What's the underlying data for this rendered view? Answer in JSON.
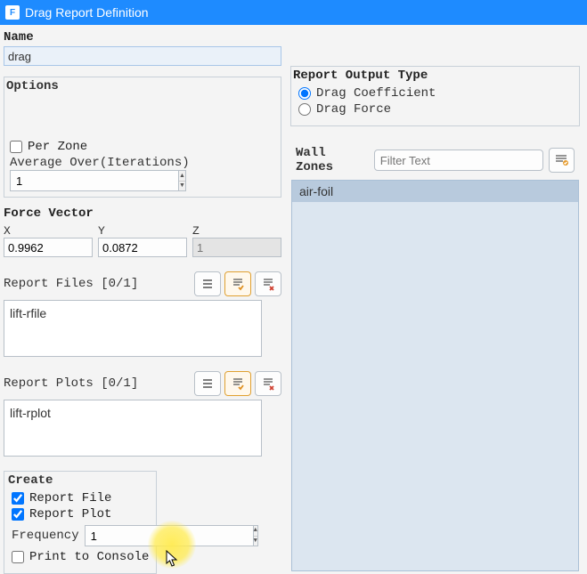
{
  "titlebar": {
    "icon": "F",
    "title": "Drag Report Definition"
  },
  "name": {
    "label": "Name",
    "value": "drag"
  },
  "options": {
    "header": "Options",
    "per_zone_label": "Per Zone",
    "per_zone_checked": false,
    "average_over_label": "Average Over(Iterations)",
    "average_over_value": "1"
  },
  "force_vector": {
    "header": "Force Vector",
    "x_label": "X",
    "x_value": "0.9962",
    "y_label": "Y",
    "y_value": "0.0872",
    "z_label": "Z",
    "z_value": "1"
  },
  "report_files": {
    "title": "Report Files [0/1]",
    "items": [
      "lift-rfile"
    ]
  },
  "report_plots": {
    "title": "Report Plots [0/1]",
    "items": [
      "lift-rplot"
    ]
  },
  "create": {
    "header": "Create",
    "report_file_label": "Report File",
    "report_file_checked": true,
    "report_plot_label": "Report Plot",
    "report_plot_checked": true,
    "frequency_label": "Frequency",
    "frequency_value": "1",
    "print_console_label": "Print to Console",
    "print_console_checked": false
  },
  "output_type": {
    "header": "Report Output Type",
    "drag_coeff_label": "Drag Coefficient",
    "drag_force_label": "Drag Force",
    "selected": "coefficient"
  },
  "wall_zones": {
    "label": "Wall Zones",
    "filter_placeholder": "Filter Text",
    "items": [
      "air-foil"
    ]
  }
}
